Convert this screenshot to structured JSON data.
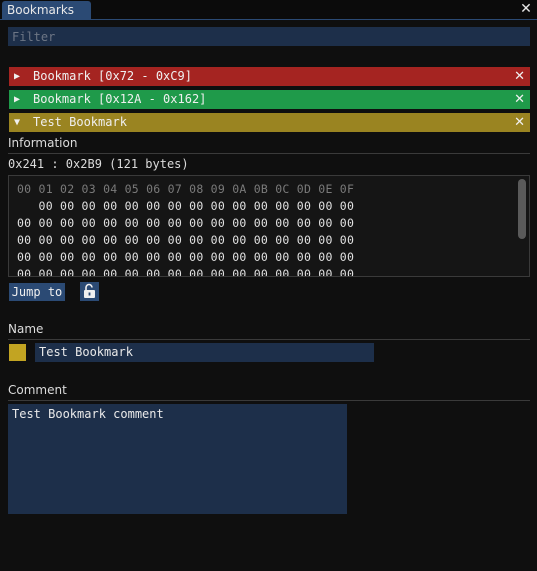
{
  "window": {
    "tab_title": "Bookmarks",
    "close_symbol": "✕"
  },
  "filter": {
    "placeholder": "Filter",
    "value": ""
  },
  "bookmarks": [
    {
      "label": "Bookmark [0x72 - 0xC9]",
      "color": "#a52421",
      "expanded": false,
      "arrow": "▶",
      "close": "✕"
    },
    {
      "label": "Bookmark [0x12A - 0x162]",
      "color": "#1f9a4a",
      "expanded": false,
      "arrow": "▶",
      "close": "✕"
    },
    {
      "label": "Test Bookmark",
      "color": "#9a8421",
      "expanded": true,
      "arrow": "▼",
      "close": "✕"
    }
  ],
  "details": {
    "information_label": "Information",
    "range_text": "0x241 : 0x2B9 (121 bytes)",
    "hex_header": "00 01 02 03 04 05 06 07 08 09 0A 0B 0C 0D 0E 0F",
    "hex_rows": [
      "   00 00 00 00 00 00 00 00 00 00 00 00 00 00 00",
      "00 00 00 00 00 00 00 00 00 00 00 00 00 00 00 00",
      "00 00 00 00 00 00 00 00 00 00 00 00 00 00 00 00",
      "00 00 00 00 00 00 00 00 00 00 00 00 00 00 00 00",
      "00 00 00 00 00 00 00 00 00 00 00 00 00 00 00 00"
    ],
    "jump_to_label": "Jump to",
    "lock_icon": "unlock-icon",
    "name_label": "Name",
    "name_value": "Test Bookmark",
    "swatch_color": "#c2a422",
    "comment_label": "Comment",
    "comment_value": "Test Bookmark comment"
  }
}
